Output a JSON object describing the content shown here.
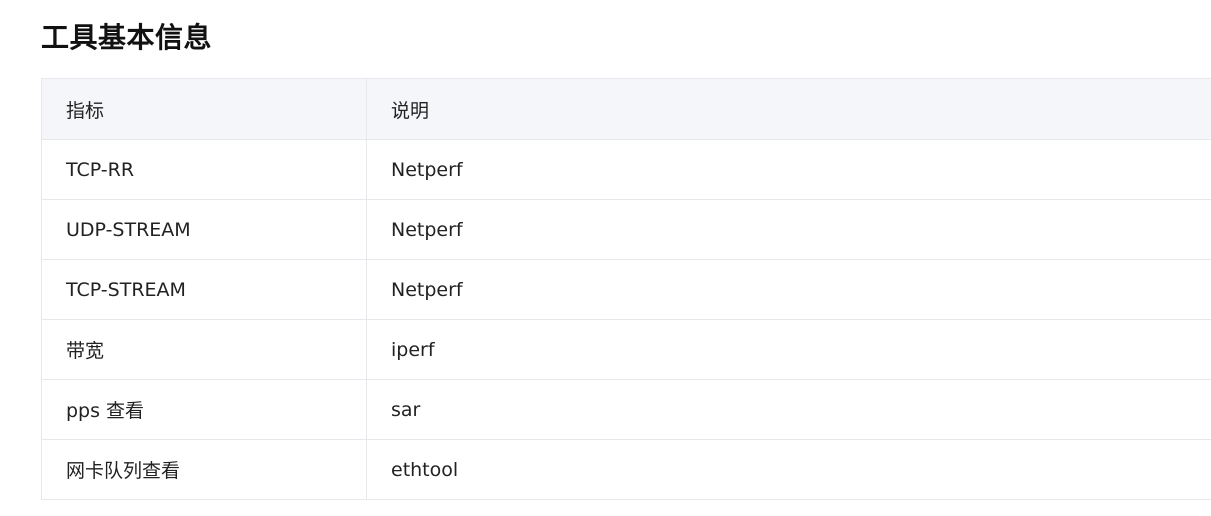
{
  "page": {
    "title": "工具基本信息"
  },
  "table": {
    "headers": [
      "指标",
      "说明"
    ],
    "rows": [
      [
        "TCP-RR",
        "Netperf"
      ],
      [
        "UDP-STREAM",
        "Netperf"
      ],
      [
        "TCP-STREAM",
        "Netperf"
      ],
      [
        "带宽",
        "iperf"
      ],
      [
        "pps 查看",
        "sar"
      ],
      [
        "网卡队列查看",
        "ethtool"
      ]
    ]
  }
}
